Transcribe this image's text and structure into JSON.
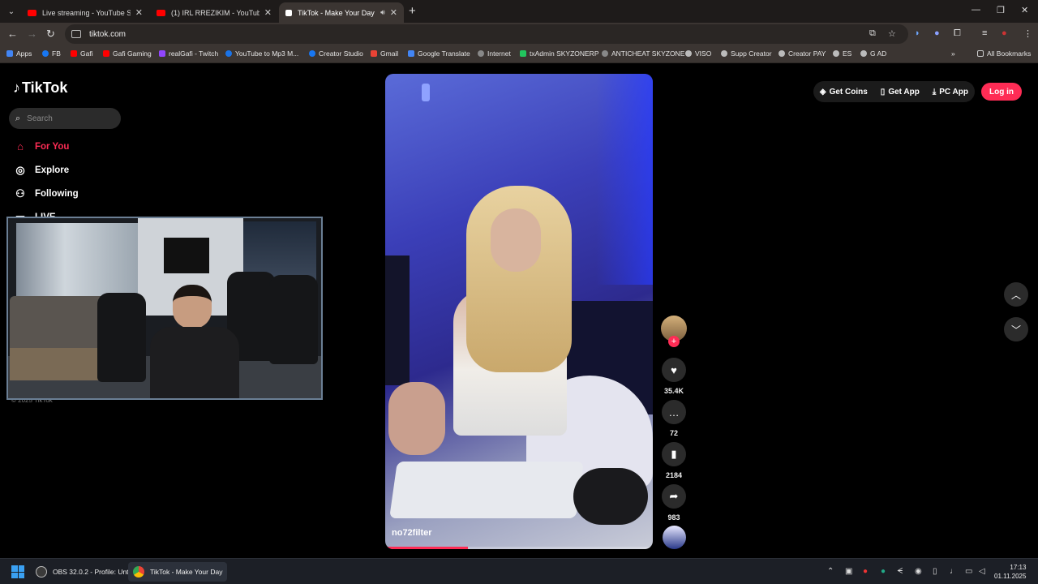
{
  "browser": {
    "tabs": [
      {
        "title": "Live streaming - YouTube Studio",
        "fav_color": "#ff0000"
      },
      {
        "title": "(1) IRL RREZIKIM - YouTube",
        "fav_color": "#ff0000"
      },
      {
        "title": "TikTok - Make Your Day",
        "fav_color": "#ffffff"
      }
    ],
    "url": "tiktok.com",
    "bookmarks": [
      {
        "label": "Apps",
        "color": "#4285f4"
      },
      {
        "label": "FB",
        "color": "#1877f2"
      },
      {
        "label": "Gafi",
        "color": "#ff0000"
      },
      {
        "label": "Gafi Gaming",
        "color": "#ff0000"
      },
      {
        "label": "realGafi - Twitch",
        "color": "#9146ff"
      },
      {
        "label": "YouTube to Mp3 M...",
        "color": "#1a73e8"
      },
      {
        "label": "Creator Studio",
        "color": "#1877f2"
      },
      {
        "label": "Gmail",
        "color": "#ea4335"
      },
      {
        "label": "Google Translate",
        "color": "#4285f4"
      },
      {
        "label": "Internet",
        "color": "#888888"
      },
      {
        "label": "txAdmin SKYZONERP",
        "color": "#22c55e"
      },
      {
        "label": "ANTICHEAT SKYZONE",
        "color": "#888888"
      },
      {
        "label": "VISO",
        "color": "#bbbbbb"
      },
      {
        "label": "Supp Creator",
        "color": "#bbbbbb"
      },
      {
        "label": "Creator PAY",
        "color": "#bbbbbb"
      },
      {
        "label": "ES",
        "color": "#bbbbbb"
      },
      {
        "label": "G AD",
        "color": "#bbbbbb"
      }
    ],
    "all_bookmarks": "All Bookmarks"
  },
  "tiktok": {
    "logo": "TikTok",
    "search_placeholder": "Search",
    "nav": [
      {
        "label": "For You",
        "icon": "home-icon"
      },
      {
        "label": "Explore",
        "icon": "compass-icon"
      },
      {
        "label": "Following",
        "icon": "following-icon"
      },
      {
        "label": "LIVE",
        "icon": "live-icon"
      }
    ],
    "copyright": "© 2025 TikTok",
    "header": {
      "get_coins": "Get Coins",
      "get_app": "Get App",
      "pc_app": "PC App",
      "login": "Log in"
    },
    "video": {
      "username": "no72filter",
      "progress": 0.31
    },
    "actions": {
      "likes": "35.4K",
      "comments": "72",
      "saves": "2184",
      "shares": "983"
    }
  },
  "taskbar": {
    "apps": [
      {
        "label": "OBS 32.0.2 - Profile: Unt",
        "color": "#3a3a3a"
      },
      {
        "label": "TikTok - Make Your Day",
        "color": "#e8453c"
      }
    ],
    "time": "17:13",
    "date": "01.11.2025"
  },
  "colors": {
    "accent": "#fe2c55"
  }
}
